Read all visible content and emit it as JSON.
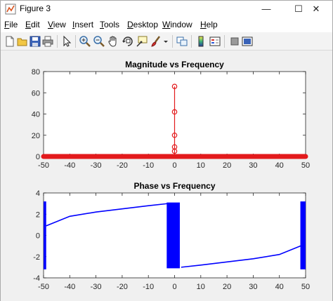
{
  "window": {
    "title": "Figure 3",
    "minimize_glyph": "—",
    "maximize_glyph": "☐",
    "close_glyph": "✕"
  },
  "menu": [
    {
      "label": "File",
      "u": "F",
      "rest": "ile"
    },
    {
      "label": "Edit",
      "u": "E",
      "rest": "dit"
    },
    {
      "label": "View",
      "u": "V",
      "rest": "iew"
    },
    {
      "label": "Insert",
      "u": "I",
      "rest": "nsert"
    },
    {
      "label": "Tools",
      "u": "T",
      "rest": "ools"
    },
    {
      "label": "Desktop",
      "u": "D",
      "rest": "esktop"
    },
    {
      "label": "Window",
      "u": "W",
      "rest": "indow"
    },
    {
      "label": "Help",
      "u": "H",
      "rest": "elp"
    }
  ],
  "toolbar_icons": [
    "new-figure-icon",
    "open-file-icon",
    "save-icon",
    "print-icon",
    "edit-plot-arrow-icon",
    "zoom-in-icon",
    "zoom-out-icon",
    "pan-hand-icon",
    "rotate-3d-icon",
    "data-cursor-icon",
    "brush-icon",
    "brush-dropdown-icon",
    "link-plot-icon",
    "insert-colorbar-icon",
    "insert-legend-icon",
    "hide-plot-tools-icon",
    "show-plot-tools-icon"
  ],
  "colors": {
    "magnitude": "#e31a1c",
    "phase": "#0000ff"
  },
  "chart_data": [
    {
      "type": "stem",
      "title": "Magnitude vs Frequency",
      "xlim": [
        -50,
        50
      ],
      "ylim": [
        0,
        80
      ],
      "xticks": [
        -50,
        -40,
        -30,
        -20,
        -10,
        0,
        10,
        20,
        30,
        40,
        50
      ],
      "yticks": [
        0,
        20,
        40,
        60,
        80
      ],
      "baseline": 0,
      "peaks": [
        {
          "x": 0,
          "y": 66
        },
        {
          "x": 0,
          "y": 42
        },
        {
          "x": 0,
          "y": 20
        },
        {
          "x": 0,
          "y": 9
        },
        {
          "x": 0,
          "y": 5
        }
      ]
    },
    {
      "type": "line",
      "title": "Phase vs Frequency",
      "xlim": [
        -50,
        50
      ],
      "ylim": [
        -4,
        4
      ],
      "xticks": [
        -50,
        -40,
        -30,
        -20,
        -10,
        0,
        10,
        20,
        30,
        40,
        50
      ],
      "yticks": [
        -4,
        -2,
        0,
        2,
        4
      ],
      "segments": [
        {
          "x": [
            -49,
            -40,
            -30,
            -20,
            -10,
            -2.5
          ],
          "y": [
            0.9,
            1.8,
            2.2,
            2.5,
            2.8,
            3.0
          ]
        },
        {
          "x": [
            2.5,
            10,
            20,
            30,
            40,
            49
          ],
          "y": [
            -3.0,
            -2.8,
            -2.5,
            -2.2,
            -1.8,
            -0.9
          ]
        }
      ],
      "oscillation_bands": [
        {
          "x": [
            -50,
            -49
          ],
          "y": [
            -3.2,
            3.2
          ]
        },
        {
          "x": [
            -3,
            2
          ],
          "y": [
            -3.1,
            3.1
          ]
        },
        {
          "x": [
            48,
            50
          ],
          "y": [
            -3.2,
            3.2
          ]
        }
      ]
    }
  ]
}
